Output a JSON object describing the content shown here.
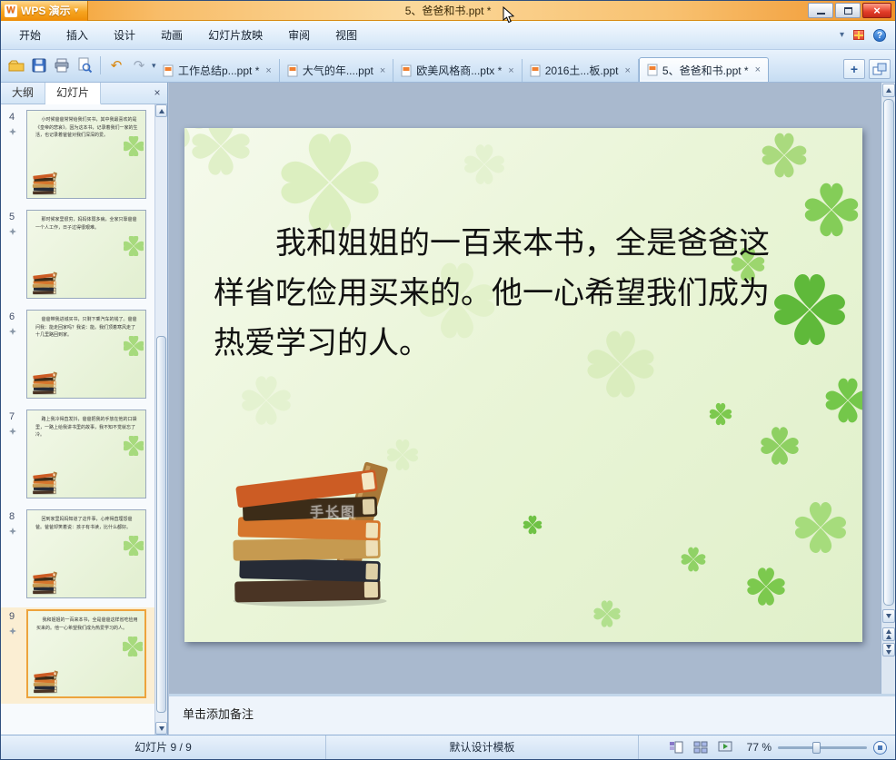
{
  "colors": {
    "titlebar_orange": "#f59b1e",
    "menubar_blue": "#dcebf9",
    "canvas_gray_blue": "#a9b9ce",
    "slide_green_light": "#eaf5d8",
    "clover_green_dark": "#5fb93a",
    "selected_thumb_orange": "#eda33c",
    "close_button_red": "#e23c28"
  },
  "window": {
    "app_button_label": "WPS 演示",
    "title": "5、爸爸和书.ppt *"
  },
  "menubar": {
    "items": [
      "开始",
      "插入",
      "设计",
      "动画",
      "幻灯片放映",
      "审阅",
      "视图"
    ]
  },
  "doc_tabs": [
    {
      "label": "工作总结p...ppt *"
    },
    {
      "label": "大气的年....ppt"
    },
    {
      "label": "欧美风格商...ptx *"
    },
    {
      "label": "2016土...板.ppt"
    },
    {
      "label": "5、爸爸和书.ppt *"
    }
  ],
  "sidebar": {
    "outline_tab": "大纲",
    "slides_tab": "幻灯片",
    "slides": [
      {
        "num": "4",
        "text": "小时候爸爸常常给我们买书，其中我最喜欢的是《皇帝的悲哀》。因为这本书，记录着我们一家的生活，也记录着爸爸对我们深深的爱。"
      },
      {
        "num": "5",
        "text": "那时候家里很穷，妈妈体弱多病，全家只靠爸爸一个人工作，日子过得很艰难。"
      },
      {
        "num": "6",
        "text": "爸爸带我进城买书，只剩下乘汽车的钱了。爸爸问我：能走回家吗？我说：能。我们顶着寒风走了十几里路回到家。"
      },
      {
        "num": "7",
        "text": "路上我冷得直发抖，爸爸把我的手放在他的口袋里，一路上给我讲书里的故事，我不知不觉就忘了冷。"
      },
      {
        "num": "8",
        "text": "回到家里妈妈知道了这件事，心疼得直埋怨爸爸。爸爸却笑着说：孩子有书读，比什么都好。"
      },
      {
        "num": "9",
        "text": "我和姐姐的一百来本书，全是爸爸这样省吃俭用买来的。他一心希望我们成为热爱学习的人。"
      }
    ]
  },
  "slide": {
    "body_text": "我和姐姐的一百来本书，全是爸爸这样省吃俭用买来的。他一心希望我们成为热爱学习的人。",
    "watermark": "手长图"
  },
  "notes": {
    "placeholder": "单击添加备注"
  },
  "statusbar": {
    "slide_counter": "幻灯片 9 / 9",
    "template_name": "默认设计模板",
    "zoom_value": "77 %"
  }
}
